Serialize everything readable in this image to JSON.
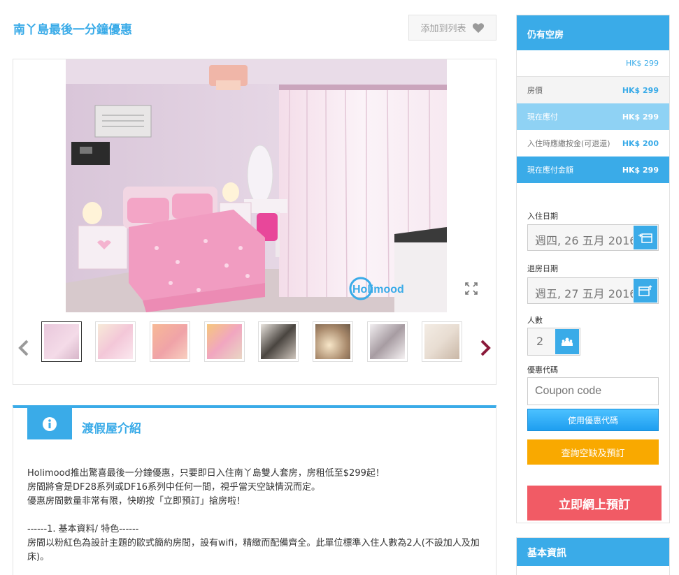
{
  "page": {
    "title": "南丫島最後一分鐘優惠",
    "wishlist_label": "添加到列表"
  },
  "gallery": {
    "watermark": "Holimood",
    "thumbnails": [
      {
        "name": "thumb-1",
        "active": true
      },
      {
        "name": "thumb-2",
        "active": false
      },
      {
        "name": "thumb-3",
        "active": false
      },
      {
        "name": "thumb-4",
        "active": false
      },
      {
        "name": "thumb-5",
        "active": false
      },
      {
        "name": "thumb-6",
        "active": false
      },
      {
        "name": "thumb-7",
        "active": false
      },
      {
        "name": "thumb-8",
        "active": false
      }
    ]
  },
  "intro": {
    "title": "渡假屋介紹",
    "icon": "info-icon",
    "lines": [
      "Holimood推出驚喜最後一分鐘優惠，只要即日入住南丫島雙人套房，房租低至$299起！",
      "房間將會是DF28系列或DF16系列中任何一間，視乎當天空缺情況而定。",
      "優惠房間數量非常有限，快啲按「立即預訂」搶房啦！",
      "",
      "------1. 基本資料/ 特色------",
      "房間以粉紅色為設計主題的歐式簡約房間，設有wifi，精緻而配備齊全。此單位標準入住人數為2人(不設加人及加床)。"
    ]
  },
  "booking": {
    "header": "仍有空房",
    "from_price": "HK$ 299",
    "rows": [
      {
        "label": "房價",
        "value": "HK$ 299",
        "style": "grey"
      },
      {
        "label": "現在應付",
        "value": "HK$ 299",
        "style": "light"
      },
      {
        "label": "入住時應繳按金(可退還)",
        "value": "HK$ 200",
        "style": "white"
      },
      {
        "label": "現在應付金額",
        "value": "HK$ 299",
        "style": "blue"
      }
    ],
    "checkin_label": "入住日期",
    "checkin_value": "週四, 26 五月 2016",
    "checkout_label": "退房日期",
    "checkout_value": "週五, 27 五月 2016",
    "guests_label": "人數",
    "guests_value": "2",
    "coupon_label": "優惠代碼",
    "coupon_placeholder": "Coupon code",
    "coupon_button": "使用優惠代碼",
    "check_button": "查詢空缺及預訂",
    "book_button": "立即網上預訂"
  },
  "info": {
    "header": "基本資訊"
  },
  "colors": {
    "accent": "#3aabe8",
    "orange": "#f9a900",
    "red": "#f15b65"
  }
}
